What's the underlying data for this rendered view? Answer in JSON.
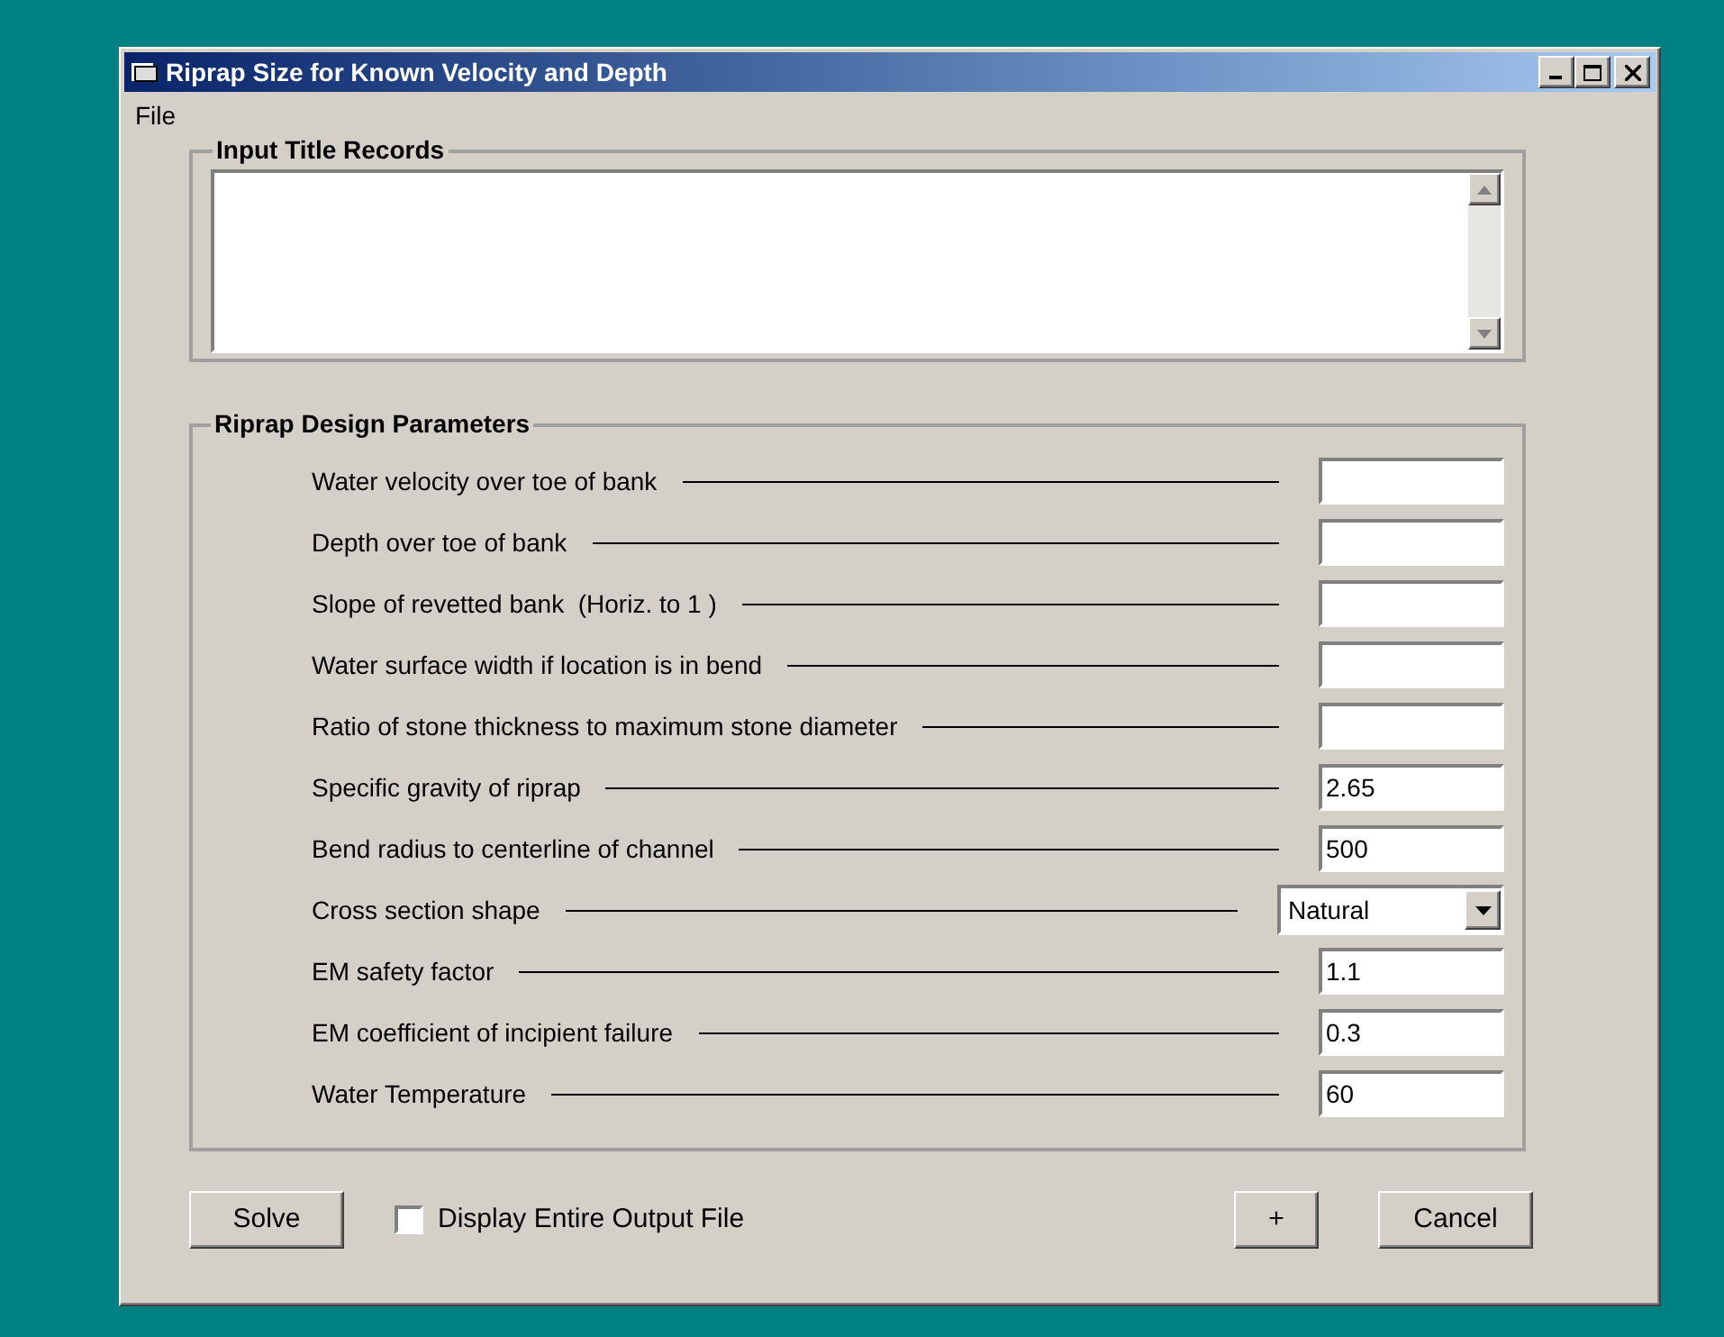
{
  "window": {
    "title": "Riprap Size for Known Velocity and Depth"
  },
  "menu": [
    "File"
  ],
  "title_records": {
    "legend": "Input Title Records"
  },
  "parameters": {
    "legend": "Riprap Design Parameters",
    "rows": [
      {
        "kind": "text",
        "label": "Water velocity over toe of bank"
      },
      {
        "kind": "text",
        "label": "Depth over toe of bank"
      },
      {
        "kind": "text",
        "label": "Slope of revetted bank  (Horiz. to 1 )"
      },
      {
        "kind": "text",
        "label": "Water surface width if location is in bend"
      },
      {
        "kind": "text",
        "label": "Ratio of stone thickness to maximum stone diameter"
      },
      {
        "kind": "text",
        "label": "Specific gravity of riprap",
        "value": "2.65"
      },
      {
        "kind": "text",
        "label": "Bend radius to centerline of channel",
        "value": "500"
      },
      {
        "kind": "dropdown",
        "label": "Cross section shape",
        "value": "Natural"
      },
      {
        "kind": "text",
        "label": "EM safety factor",
        "value": "1.1"
      },
      {
        "kind": "text",
        "label": "EM coefficient of incipient failure",
        "value": "0.3"
      },
      {
        "kind": "text",
        "label": "Water Temperature",
        "value": "60"
      }
    ]
  },
  "solve_button": "Solve",
  "checkbox": {
    "label": "Display Entire Output File",
    "checked": false
  },
  "plus_button": "+",
  "cancel_button": "Cancel"
}
